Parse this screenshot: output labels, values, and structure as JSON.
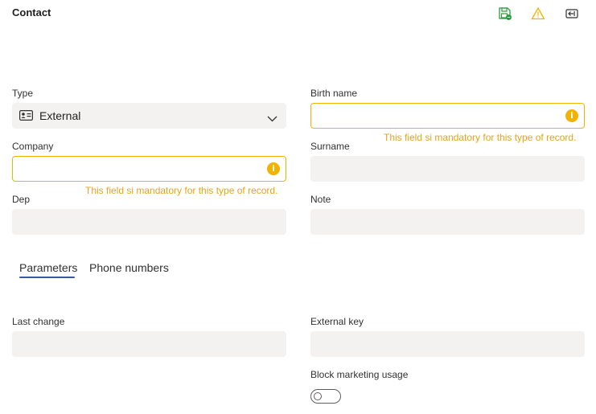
{
  "header": {
    "title": "Contact",
    "icons": [
      "save-icon",
      "warning-icon",
      "exit-icon"
    ]
  },
  "form": {
    "type": {
      "label": "Type",
      "value": "External",
      "icon": "contact-card-icon"
    },
    "birth_name": {
      "label": "Birth name",
      "value": "",
      "warning": "This field si mandatory for this type of record."
    },
    "company": {
      "label": "Company",
      "value": "",
      "warning": "This field si mandatory for this type of record."
    },
    "surname": {
      "label": "Surname",
      "value": ""
    },
    "dep": {
      "label": "Dep",
      "value": ""
    },
    "note": {
      "label": "Note",
      "value": ""
    }
  },
  "tabs": [
    {
      "label": "Parameters",
      "active": true
    },
    {
      "label": "Phone numbers",
      "active": false
    }
  ],
  "parameters": {
    "last_change": {
      "label": "Last change",
      "value": ""
    },
    "external_key": {
      "label": "External key",
      "value": ""
    },
    "block_marketing": {
      "label": "Block marketing usage",
      "value": false
    }
  },
  "colors": {
    "accent": "#3b57a3",
    "warning": "#f2b200",
    "warning_text": "#e3a41a",
    "save_green": "#2e9a3e"
  }
}
